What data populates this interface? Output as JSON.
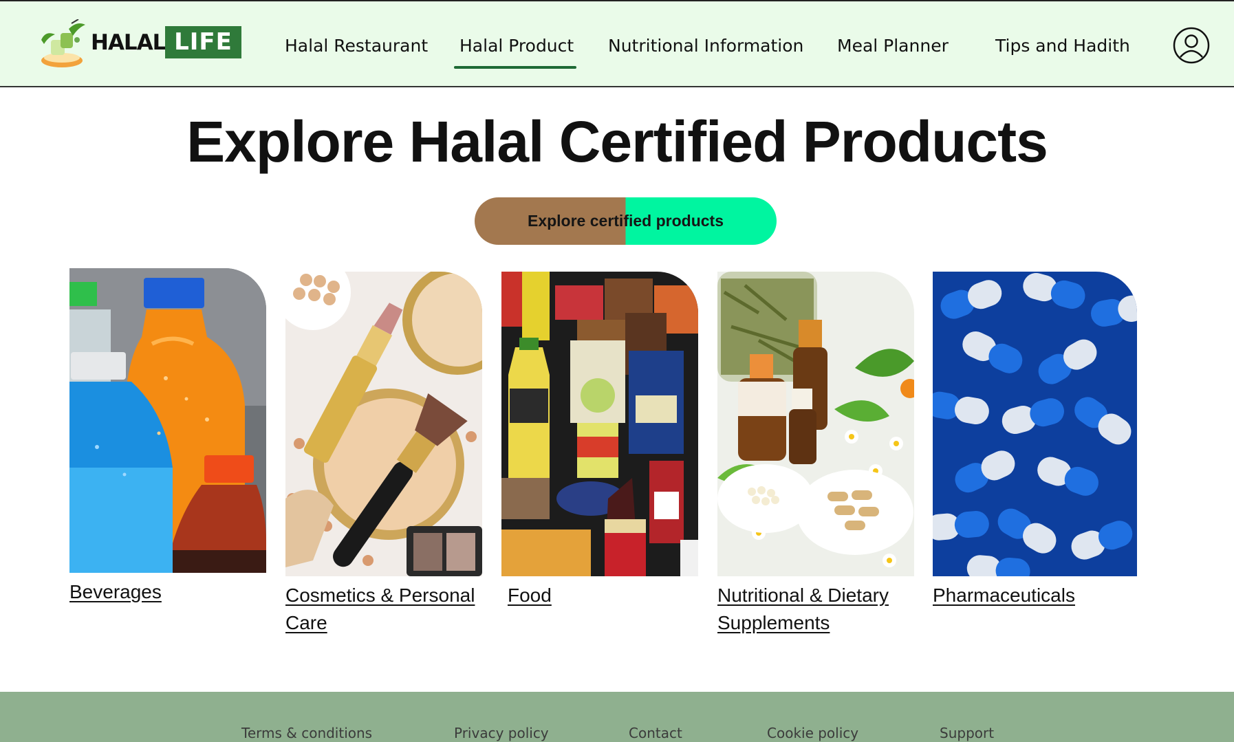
{
  "brand": {
    "word1": "HALAL",
    "word2": "LIFE",
    "accent": "#2f7a3a",
    "header_bg": "#eafbe9"
  },
  "nav": {
    "items": [
      {
        "label": "Halal Restaurant"
      },
      {
        "label": "Halal Product",
        "active": true
      },
      {
        "label": "Nutritional Information"
      },
      {
        "label": "Meal Planner"
      },
      {
        "label": "Tips and Hadith"
      }
    ],
    "profile_icon": "user-circle-icon"
  },
  "hero": {
    "title": "Explore Halal Certified Products",
    "cta_label": "Explore certified products",
    "cta_colors": [
      "#a3784f",
      "#00f5a0"
    ]
  },
  "categories": [
    {
      "label": "Beverages",
      "image": "beverage-bottles"
    },
    {
      "label": "Cosmetics & Personal Care",
      "image": "cosmetics"
    },
    {
      "label": "Food",
      "image": "packaged-food"
    },
    {
      "label": "Nutritional & Dietary Supplements",
      "image": "supplements"
    },
    {
      "label": "Pharmaceuticals",
      "image": "capsules"
    }
  ],
  "footer": {
    "background": "#8fb08f",
    "links": [
      "Terms & conditions",
      "Privacy policy",
      "Contact",
      "Cookie policy",
      "Support"
    ]
  }
}
